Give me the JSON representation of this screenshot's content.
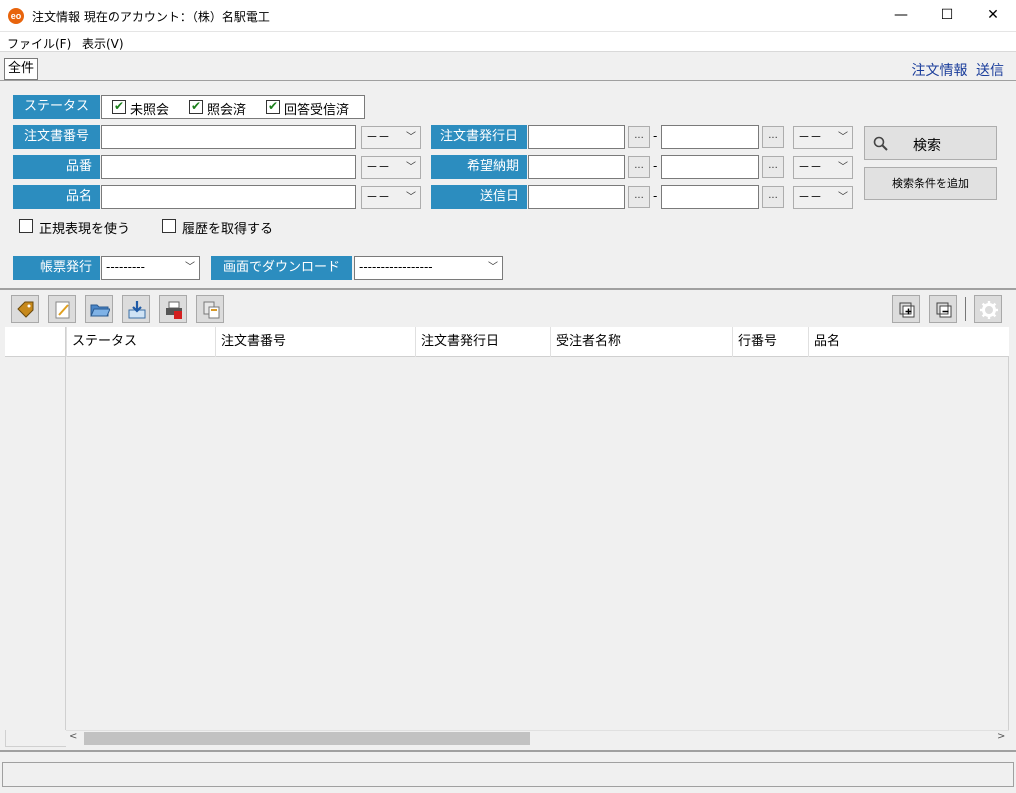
{
  "window": {
    "title": "注文情報 現在のアカウント：（株）名駅電工",
    "icon_text": "eo",
    "minimize": "—",
    "maximize": "☐",
    "close": "✕"
  },
  "menu": [
    "ファイル(F)",
    "表示(V)"
  ],
  "tab": {
    "label": "全件"
  },
  "top_links": [
    "注文情報",
    "送信"
  ],
  "search": {
    "status_label": "ステータス",
    "status_options": [
      {
        "label": "未照会",
        "checked": true
      },
      {
        "label": "照会済",
        "checked": true
      },
      {
        "label": "回答受信済",
        "checked": true
      }
    ],
    "fields": [
      {
        "label": "注文書番号",
        "value": "",
        "match": "－－"
      },
      {
        "label": "品番",
        "value": "",
        "match": "－－"
      },
      {
        "label": "品名",
        "value": "",
        "match": "－－"
      }
    ],
    "date_fields": [
      {
        "label": "注文書発行日",
        "from": "",
        "to": "",
        "dots": "...",
        "sep": "-",
        "match": "－－"
      },
      {
        "label": "希望納期",
        "from": "",
        "to": "",
        "dots": "...",
        "sep": "-",
        "match": "－－"
      },
      {
        "label": "送信日",
        "from": "",
        "to": "",
        "dots": "...",
        "sep": "-",
        "match": "－－"
      }
    ],
    "search_button": "検索",
    "add_condition_button": "検索条件を追加",
    "regex_option": {
      "label": "正規表現を使う",
      "checked": false
    },
    "history_option": {
      "label": "履歴を取得する",
      "checked": false
    },
    "report_label": "帳票発行",
    "report_value": "---------",
    "download_label": "画面でダウンロード",
    "download_value": "-----------------"
  },
  "toolbar": {
    "icons": [
      "tag-icon",
      "edit-icon",
      "folder-open-icon",
      "import-icon",
      "print-pdf-icon",
      "copy-icon"
    ],
    "right_icons": [
      "expand-icon",
      "collapse-icon",
      "settings-icon"
    ]
  },
  "grid": {
    "columns": [
      "ステータス",
      "注文書番号",
      "注文書発行日",
      "受注者名称",
      "行番号",
      "品名"
    ],
    "rows": []
  },
  "colors": {
    "label_bg": "#2c8dbf",
    "link": "#1a3d9b",
    "app_icon": "#e8640c"
  }
}
